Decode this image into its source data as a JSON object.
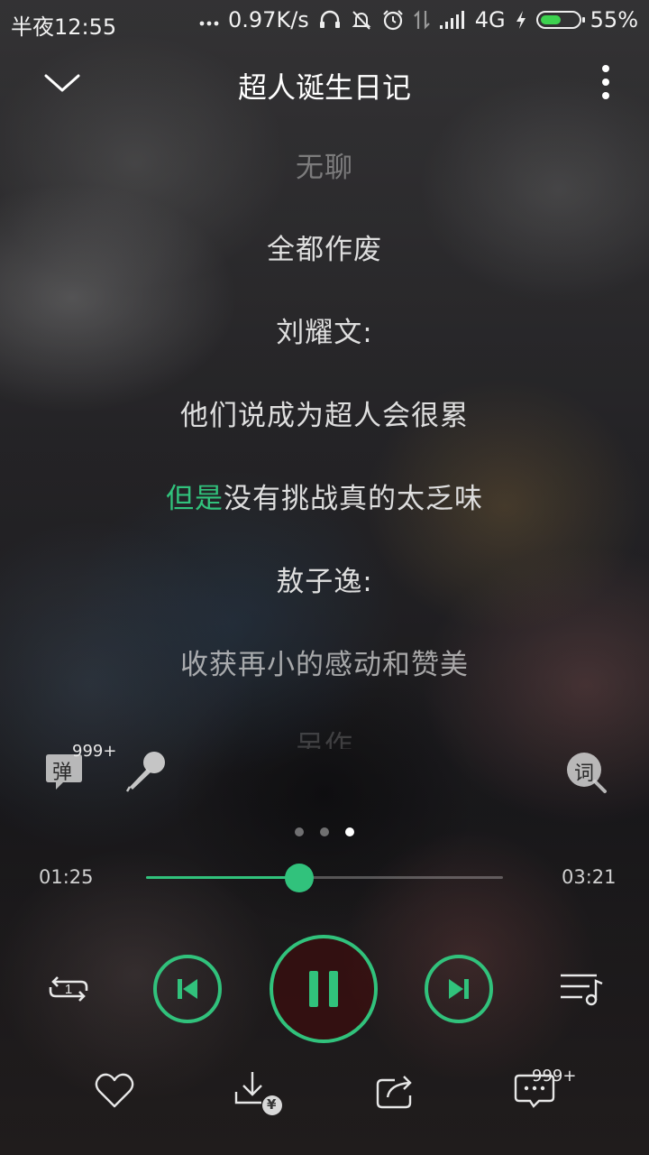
{
  "status_bar": {
    "time": "半夜12:55",
    "network_speed": "0.97K/s",
    "network_type": "4G",
    "battery_percent": "55%",
    "battery_level": 0.55,
    "icons": [
      "more-dots-icon",
      "headphones-icon",
      "mute-bell-icon",
      "alarm-icon",
      "data-transfer-icon",
      "signal-icon",
      "charging-icon",
      "battery-icon"
    ]
  },
  "header": {
    "title": "超人诞生日记",
    "back_icon": "chevron-down-icon",
    "more_icon": "more-vertical-icon"
  },
  "lyrics": {
    "lines": [
      {
        "text": "无聊",
        "state": "dim"
      },
      {
        "text": "全都作废",
        "state": "normal"
      },
      {
        "text": "刘耀文:",
        "state": "normal"
      },
      {
        "text": "他们说成为超人会很累",
        "state": "normal"
      },
      {
        "highlight": "但是",
        "rest": "没有挑战真的太乏味",
        "state": "current"
      },
      {
        "text": "敖子逸:",
        "state": "normal"
      },
      {
        "text": "收获再小的感动和赞美",
        "state": "mid"
      },
      {
        "text": "另作",
        "state": "fade"
      }
    ]
  },
  "tools": {
    "danmaku_label": "弹",
    "danmaku_count": "999+",
    "mic_icon": "microphone-icon",
    "lyrics_search_label": "词"
  },
  "pager": {
    "count": 3,
    "active_index": 2
  },
  "progress": {
    "current_time": "01:25",
    "total_time": "03:21",
    "fraction": 0.43
  },
  "controls": {
    "repeat_count": "1",
    "icons": [
      "repeat-one-icon",
      "previous-icon",
      "pause-icon",
      "next-icon",
      "playlist-icon"
    ]
  },
  "actions": {
    "comment_count": "999+",
    "download_price_label": "¥",
    "icons": [
      "heart-icon",
      "download-icon",
      "share-icon",
      "comment-icon"
    ]
  },
  "colors": {
    "accent": "#31c27c",
    "text": "#dedede"
  }
}
